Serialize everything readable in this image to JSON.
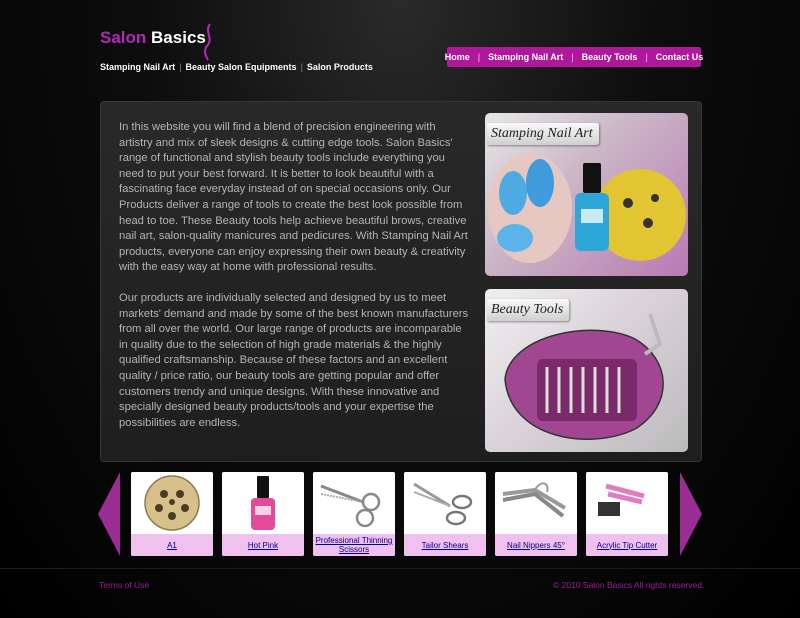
{
  "header": {
    "logo_part1": "Salon",
    "logo_part2": "Basics",
    "subnav": [
      "Stamping Nail Art",
      "Beauty Salon Equipments",
      "Salon Products"
    ],
    "mainnav": [
      "Home",
      "Stamping Nail Art",
      "Beauty Tools",
      "Contact Us"
    ]
  },
  "content": {
    "paragraph1": "In this website you will find a blend of precision engineering with artistry and mix of sleek designs & cutting edge tools. Salon Basics' range of functional and stylish beauty tools include everything you need to put your best forward. It is better to look beautiful with a fascinating face everyday instead of on special occasions only. Our Products deliver a range of tools to create the best look possible from head to toe. These Beauty tools help achieve beautiful brows, creative nail art, salon-quality manicures and pedicures. With Stamping Nail Art products, everyone can enjoy expressing their own beauty & creativity with the easy way at home with professional results.",
    "paragraph2": "Our products are individually selected and designed by us to meet markets' demand and made by some of the best known manufacturers from all over the world. Our large range of products are incomparable in quality due to the selection of high grade materials & the highly qualified craftsmanship. Because of these factors and an excellent quality / price ratio, our beauty tools are getting popular and offer customers trendy and unique designs. With these innovative and specially designed beauty products/tools and your expertise the possibilities are endless."
  },
  "features": [
    {
      "label": "Stamping Nail Art",
      "icon": "nail-polish-image"
    },
    {
      "label": "Beauty Tools",
      "icon": "manicure-kit-image"
    }
  ],
  "products": [
    {
      "name": "A1",
      "icon": "stamping-plate-icon"
    },
    {
      "name": "Hot Pink",
      "icon": "nail-polish-icon"
    },
    {
      "name": "Professional Thinning Scissors",
      "icon": "thinning-scissors-icon"
    },
    {
      "name": "Tailor Shears",
      "icon": "tailor-shears-icon"
    },
    {
      "name": "Nail Nippers 45°",
      "icon": "nail-nippers-icon"
    },
    {
      "name": "Acrylic Tip Cutter",
      "icon": "tip-cutter-icon"
    }
  ],
  "footer": {
    "terms": "Terms of Use",
    "copyright": "© 2010 Salon Basics All rights reserved."
  },
  "colors": {
    "accent": "#b0189b",
    "pink_label": "#f0c0ee"
  }
}
